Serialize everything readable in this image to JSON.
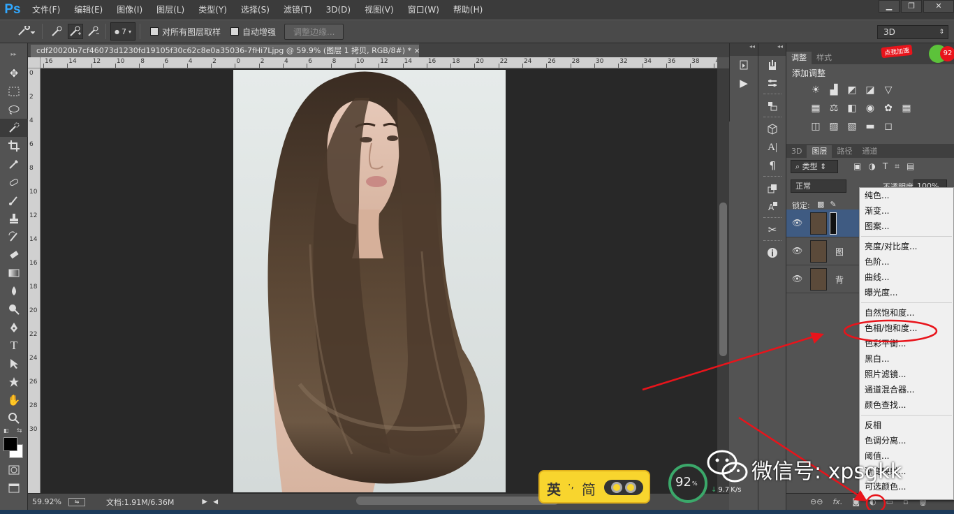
{
  "app": {
    "logo": "Ps"
  },
  "menu": [
    "文件(F)",
    "编辑(E)",
    "图像(I)",
    "图层(L)",
    "类型(Y)",
    "选择(S)",
    "滤镜(T)",
    "3D(D)",
    "视图(V)",
    "窗口(W)",
    "帮助(H)"
  ],
  "window_controls": {
    "minimize": "▁",
    "restore": "❐",
    "close": "✕"
  },
  "options": {
    "brush_size": "7",
    "sample_all_layers": "对所有图层取样",
    "auto_enhance": "自动增强",
    "refine_edge": "调整边缘...",
    "workspace": "3D"
  },
  "document": {
    "tab_title": "cdf20020b7cf46073d1230fd19105f30c62c8e0a35036-7fHi7Ljpg @ 59.9% (图层 1 拷贝, RGB/8#) *",
    "tab_close": "×",
    "hruler": [
      "16",
      "14",
      "12",
      "10",
      "8",
      "6",
      "4",
      "2",
      "0",
      "2",
      "4",
      "6",
      "8",
      "10",
      "12",
      "14",
      "16",
      "18",
      "20",
      "22",
      "24",
      "26",
      "28",
      "30",
      "32",
      "34",
      "36",
      "38",
      "40"
    ],
    "vruler": [
      "0",
      "2",
      "4",
      "6",
      "8",
      "10",
      "12",
      "14",
      "16",
      "18",
      "20",
      "22",
      "24",
      "26",
      "28",
      "30"
    ]
  },
  "status": {
    "zoom": "59.92%",
    "doc_info": "文档:1.91M/6.36M"
  },
  "adjust_panel": {
    "tabs": [
      "调整",
      "样式"
    ],
    "title": "添加调整"
  },
  "layers_panel": {
    "tabs": [
      "3D",
      "图层",
      "路径",
      "通道"
    ],
    "filter": "类型",
    "blend_mode": "正常",
    "opacity_label": "不透明度:",
    "opacity_value": "100%",
    "lock_label": "锁定:",
    "layers": [
      {
        "name": "",
        "eye": "👁"
      },
      {
        "name": "图",
        "eye": "👁"
      },
      {
        "name": "背",
        "eye": "👁"
      }
    ],
    "footer": {
      "link": "⊖⊖",
      "fx": "fx."
    }
  },
  "context_menu": {
    "groups": [
      [
        "纯色...",
        "渐变...",
        "图案..."
      ],
      [
        "亮度/对比度...",
        "色阶...",
        "曲线...",
        "曝光度..."
      ],
      [
        "自然饱和度...",
        "色相/饱和度...",
        "色彩平衡...",
        "黑白...",
        "照片滤镜...",
        "通道混合器...",
        "颜色查找..."
      ],
      [
        "反相",
        "色调分离...",
        "阈值...",
        "渐变映射...",
        "可选颜色..."
      ]
    ],
    "highlighted": "色相/饱和度..."
  },
  "overlays": {
    "badge_text": "点我加速",
    "badge_count": "92",
    "ime": {
      "lang": "英",
      "punct": "·,",
      "mode": "简"
    },
    "speed": {
      "percent": "92",
      "unit": "%",
      "rate": "9.7",
      "rate_unit": "K/s"
    },
    "watermark": "微信号: xpsgkk"
  },
  "colors": {
    "annotation": "#e8141b",
    "accent": "#31a8ff"
  }
}
